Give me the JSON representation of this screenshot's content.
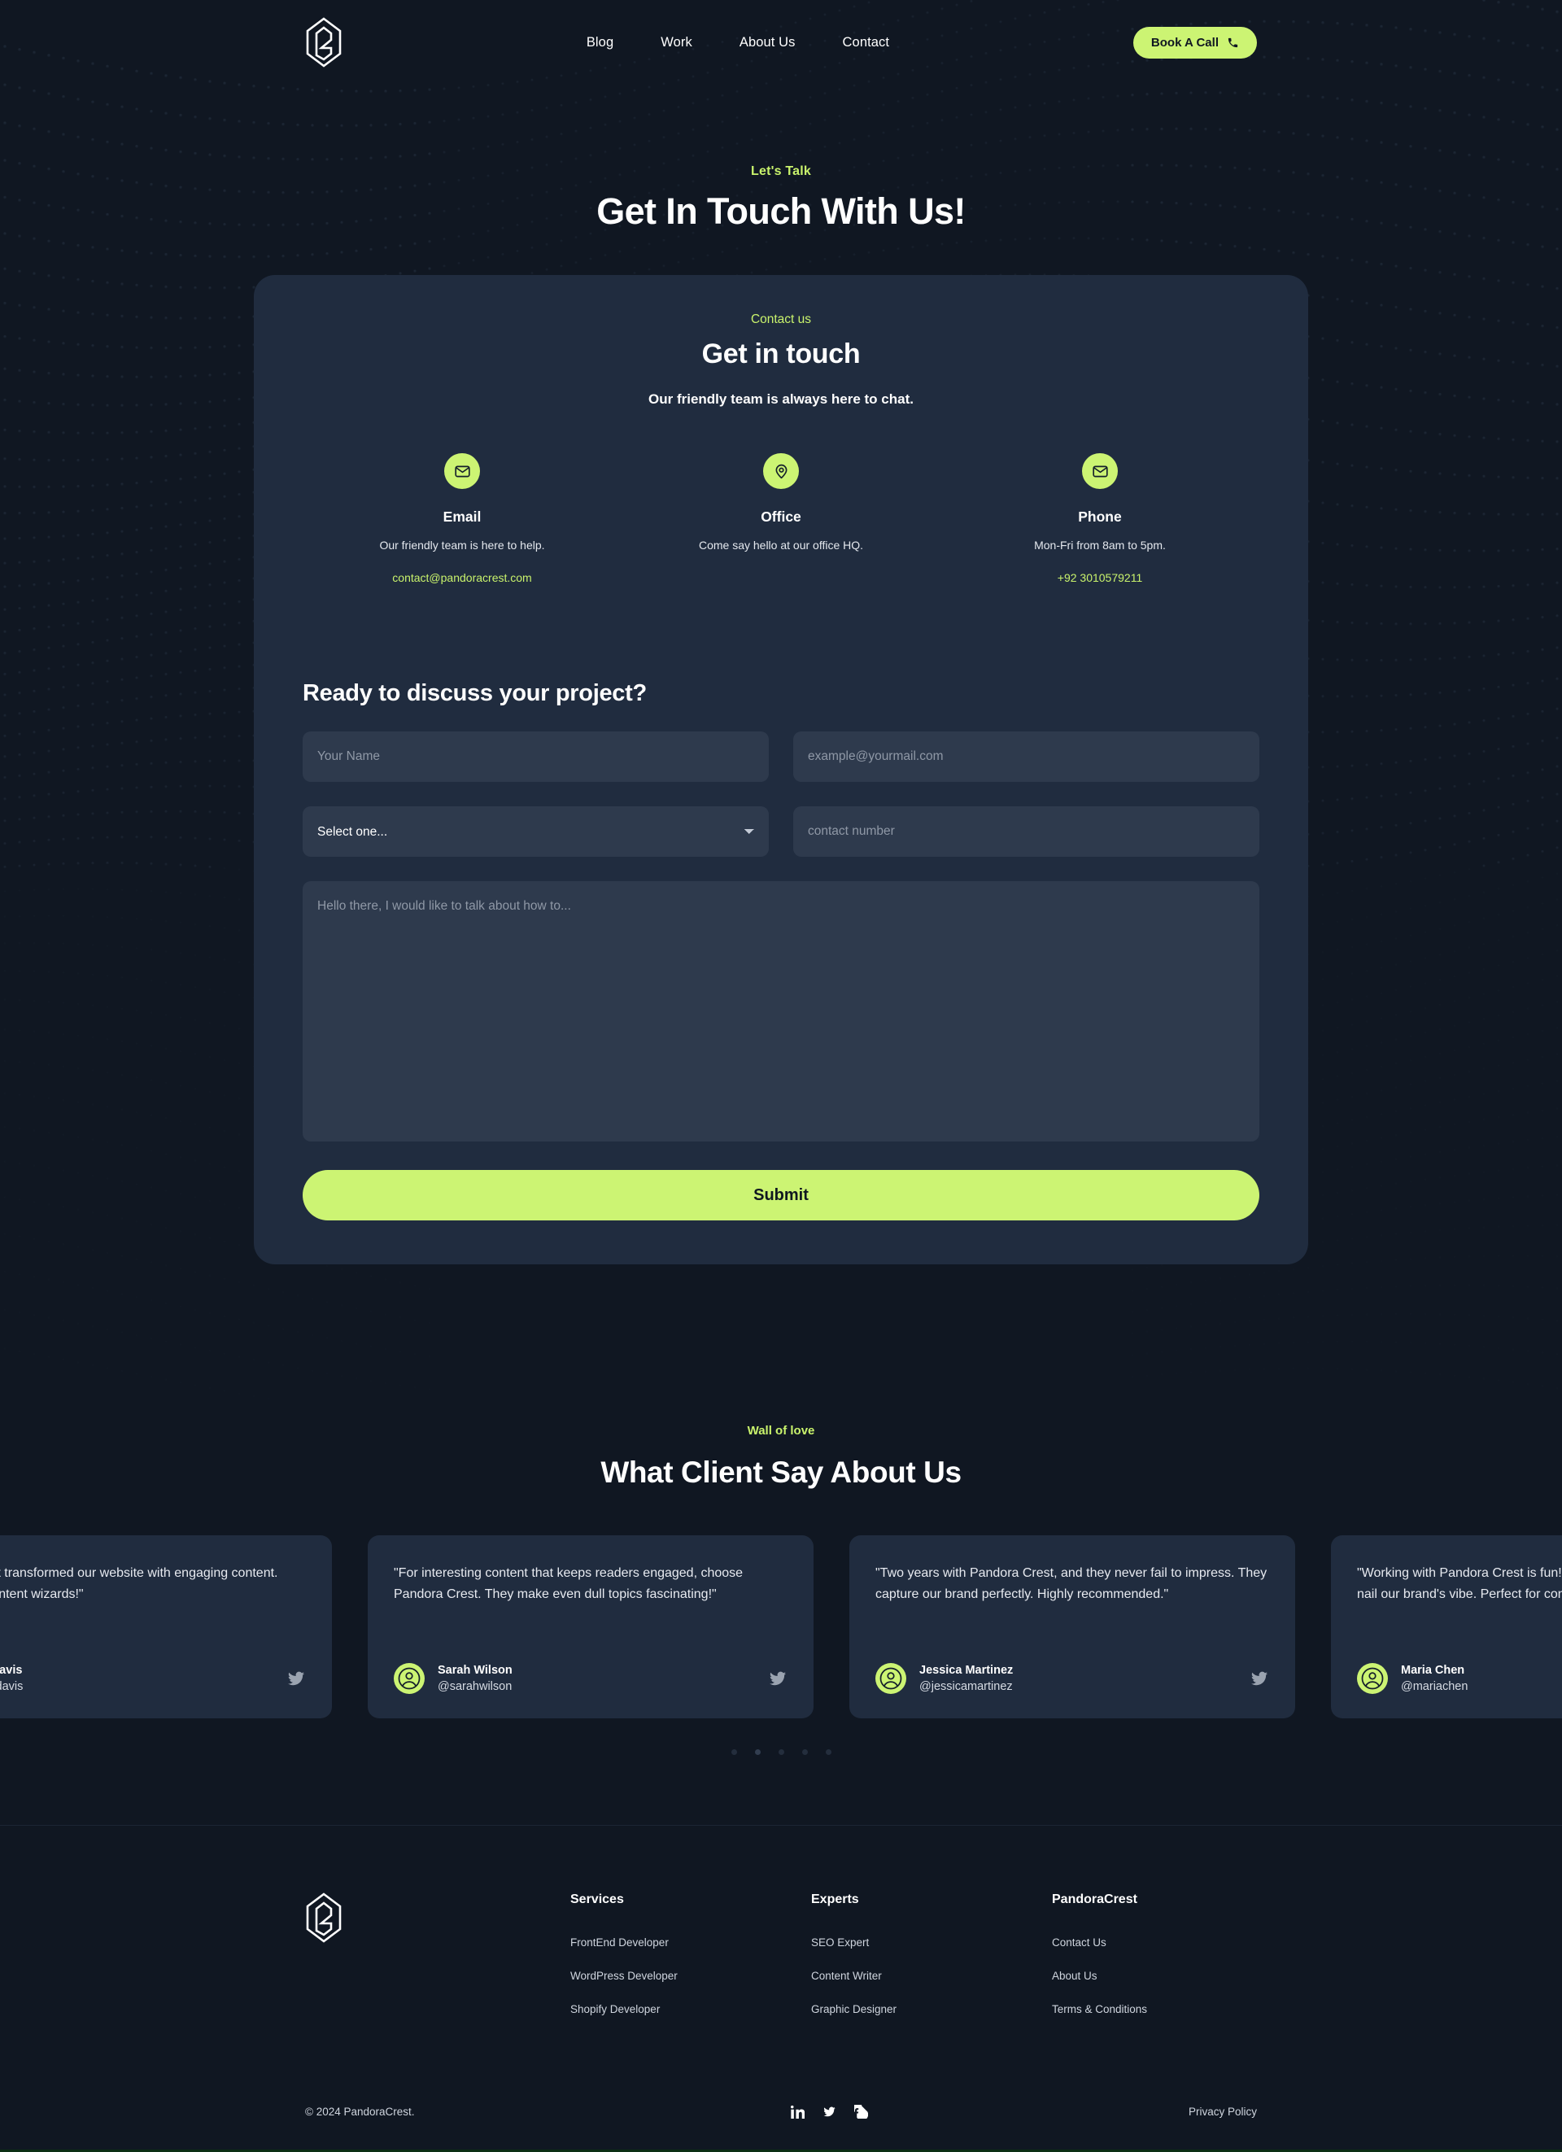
{
  "brand": {
    "name": "PandoraCrest",
    "logo_icon": "pandoracrest-logo-icon"
  },
  "colors": {
    "accent": "#ccf473",
    "background": "#101722",
    "card": "#202c3f",
    "field": "#2e3a4d"
  },
  "nav": {
    "links": [
      {
        "label": "Blog"
      },
      {
        "label": "Work"
      },
      {
        "label": "About Us"
      },
      {
        "label": "Contact"
      }
    ],
    "cta": {
      "label": "Book A Call",
      "icon": "phone-icon"
    }
  },
  "hero": {
    "eyebrow": "Let's Talk",
    "title": "Get In Touch With Us!"
  },
  "contact_card": {
    "eyebrow": "Contact us",
    "title": "Get in touch",
    "subtitle": "Our friendly team is always here to chat.",
    "methods": [
      {
        "icon": "mail-icon",
        "title": "Email",
        "description": "Our friendly team is here to help.",
        "value": "contact@pandoracrest.com"
      },
      {
        "icon": "map-pin-icon",
        "title": "Office",
        "description": "Come say hello at our office HQ.",
        "value": ""
      },
      {
        "icon": "mail-icon",
        "title": "Phone",
        "description": "Mon-Fri from 8am to 5pm.",
        "value": "+92 3010579211"
      }
    ]
  },
  "form": {
    "title": "Ready to discuss your project?",
    "name_placeholder": "Your Name",
    "name_value": "",
    "email_placeholder": "example@yourmail.com",
    "email_value": "",
    "select_value": "Select one...",
    "select_options": [
      "Select one..."
    ],
    "phone_placeholder": "contact number",
    "phone_value": "",
    "message_placeholder": "Hello there, I would like to talk about how to...",
    "message_value": "",
    "submit_label": "Submit"
  },
  "testimonials": {
    "eyebrow": "Wall of love",
    "title": "What Client Say About Us",
    "cards": [
      {
        "text": "\"Pandora Crest transformed our website with engaging content. They're true content wizards!\"",
        "name": "Emily Davis",
        "handle": "@emilydavis",
        "icon": "twitter-icon"
      },
      {
        "text": "\"For interesting content that keeps readers engaged, choose Pandora Crest. They make even dull topics fascinating!\"",
        "name": "Sarah Wilson",
        "handle": "@sarahwilson",
        "icon": "twitter-icon"
      },
      {
        "text": "\"Two years with Pandora Crest, and they never fail to impress. They capture our brand perfectly. Highly recommended.\"",
        "name": "Jessica Martinez",
        "handle": "@jessicamartinez",
        "icon": "twitter-icon"
      },
      {
        "text": "\"Working with Pandora Crest is fun! They're amazing writers who nail our brand's vibe. Perfect for content that stands out.\"",
        "name": "Maria Chen",
        "handle": "@mariachen",
        "icon": "twitter-icon"
      }
    ],
    "dots_count": 5,
    "active_dot": 2
  },
  "footer": {
    "columns": [
      {
        "title": "Services",
        "links": [
          "FrontEnd Developer",
          "WordPress Developer",
          "Shopify Developer"
        ]
      },
      {
        "title": "Experts",
        "links": [
          "SEO Expert",
          "Content Writer",
          "Graphic Designer"
        ]
      },
      {
        "title": "PandoraCrest",
        "links": [
          "Contact Us",
          "About Us",
          "Terms & Conditions"
        ]
      }
    ],
    "copyright": "© 2024 PandoraCrest.",
    "socials": [
      "linkedin-icon",
      "twitter-icon",
      "facebook-icon"
    ],
    "privacy_label": "Privacy Policy"
  }
}
